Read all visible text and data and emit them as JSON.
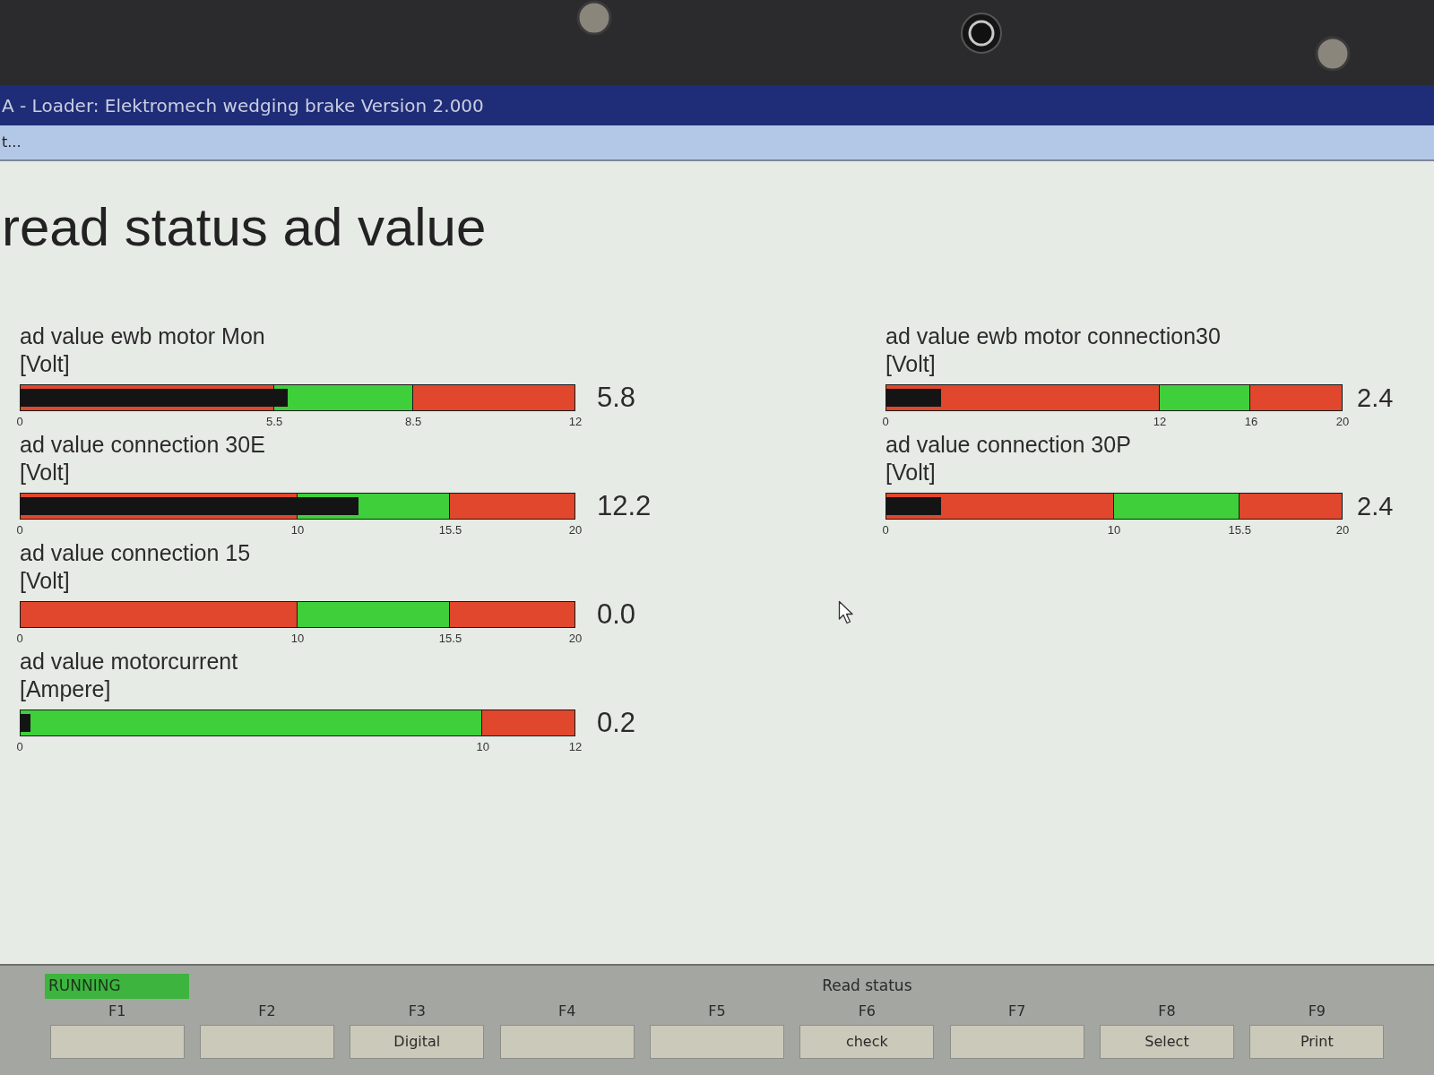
{
  "window": {
    "title": "A - Loader: Elektromech wedging brake Version 2.000"
  },
  "menu_bar": {
    "text": "t..."
  },
  "heading": "read status ad value",
  "left_gauges": [
    {
      "label": "ad value ewb motor Mon",
      "unit": "[Volt]",
      "reading": "5.8",
      "level": 0.483,
      "ticks": [
        "0",
        "5.5",
        "8.5",
        "12"
      ],
      "segments": [
        {
          "color": "#e0472d"
        },
        {
          "color": "#3fcf3a"
        },
        {
          "color": "#e0472d"
        }
      ]
    },
    {
      "label": "ad value connection 30E",
      "unit": "[Volt]",
      "reading": "12.2",
      "level": 0.61,
      "ticks": [
        "0",
        "10",
        "15.5",
        "20"
      ],
      "segments": [
        {
          "color": "#e0472d"
        },
        {
          "color": "#3fcf3a"
        },
        {
          "color": "#e0472d"
        }
      ]
    },
    {
      "label": "ad value connection 15",
      "unit": "[Volt]",
      "reading": "0.0",
      "ticks": [
        "0",
        "10",
        "15.5",
        "20"
      ],
      "segments": [
        {
          "color": "#e0472d"
        },
        {
          "color": "#3fcf3a"
        },
        {
          "color": "#e0472d"
        }
      ]
    },
    {
      "label": "ad value motorcurrent",
      "unit": "[Ampere]",
      "reading": "0.2",
      "level": 0.017,
      "ticks": [
        "0",
        "10",
        "12"
      ],
      "segments": [
        {
          "color": "#3fcf3a"
        },
        {
          "color": "#e0472d"
        }
      ]
    }
  ],
  "right_gauges": [
    {
      "label": "ad value ewb motor connection30",
      "unit": "[Volt]",
      "reading": "2.4",
      "level": 0.12,
      "ticks": [
        "0",
        "12",
        "16",
        "20"
      ],
      "segments": [
        {
          "color": "#e0472d"
        },
        {
          "color": "#3fcf3a"
        },
        {
          "color": "#e0472d"
        }
      ]
    },
    {
      "label": "ad value connection 30P",
      "unit": "[Volt]",
      "reading": "2.4",
      "level": 0.12,
      "ticks": [
        "0",
        "10",
        "15.5",
        "20"
      ],
      "segments": [
        {
          "color": "#e0472d"
        },
        {
          "color": "#3fcf3a"
        },
        {
          "color": "#e0472d"
        }
      ]
    }
  ],
  "function_bar": {
    "status": "RUNNING",
    "keys": [
      {
        "key": "F1"
      },
      {
        "key": "F2"
      },
      {
        "key": "F3",
        "label": "Digital"
      },
      {
        "key": "F4"
      },
      {
        "key": "F5"
      },
      {
        "key": "F6",
        "caption": "Read status",
        "label": "check"
      },
      {
        "key": "F7"
      },
      {
        "key": "F8",
        "label": "Select"
      },
      {
        "key": "F9",
        "label": "Print"
      }
    ]
  }
}
